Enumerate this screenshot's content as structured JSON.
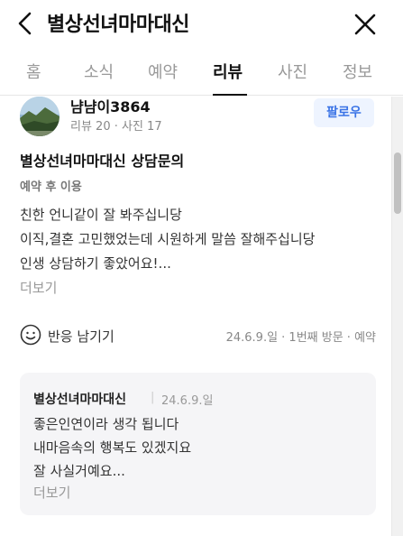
{
  "header": {
    "title": "별상선녀마마대신"
  },
  "tabs": [
    {
      "label": "홈"
    },
    {
      "label": "소식"
    },
    {
      "label": "예약"
    },
    {
      "label": "리뷰"
    },
    {
      "label": "사진"
    },
    {
      "label": "정보"
    }
  ],
  "active_tab": "리뷰",
  "reviewer": {
    "nickname": "냠냠이3864",
    "stats": "리뷰 20 · 사진 17",
    "follow_label": "팔로우"
  },
  "review": {
    "place": "별상선녀마마대신 상담문의",
    "visit_type": "예약 후 이용",
    "lines": [
      "친한 언니같이 잘 봐주십니당",
      "이직,결혼 고민했었는데 시원하게 말씀 잘해주십니당",
      "인생 상담하기 좋았어요!..."
    ],
    "more_label": "더보기",
    "react_label": "반응 남기기",
    "visit_meta": "24.6.9.일 · 1번째 방문 · 예약"
  },
  "owner_reply": {
    "name": "별상선녀마마대신",
    "separator": "|",
    "date": "24.6.9.일",
    "lines": [
      "좋은인연이라 생각 됩니다",
      "내마음속의 행복도 있겠지요",
      "잘 사실거예요..."
    ],
    "more_label": "더보기"
  },
  "colors": {
    "accent_blue": "#3a73e6",
    "follow_bg": "#eef4ff",
    "reply_bg": "#f5f5f7"
  }
}
